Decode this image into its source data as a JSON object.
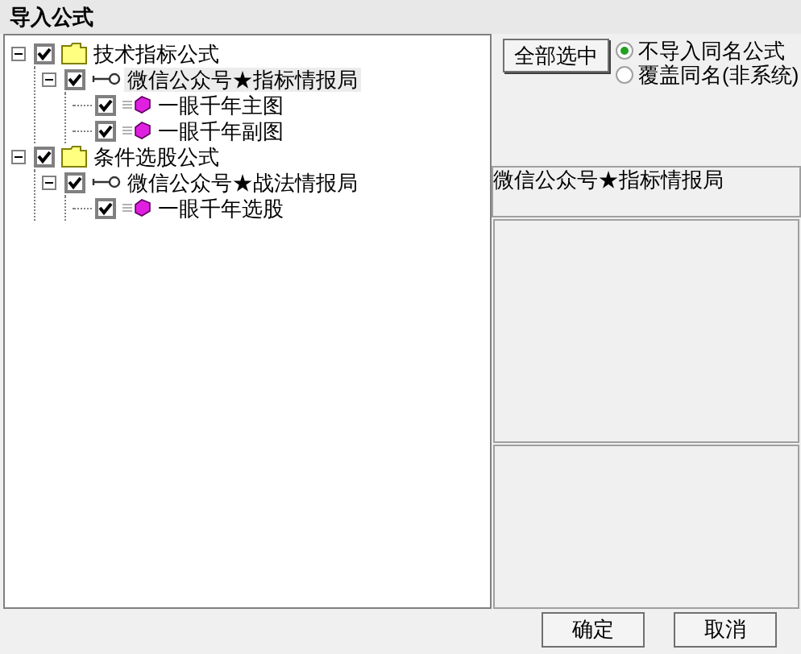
{
  "window": {
    "title": "导入公式"
  },
  "tree": [
    {
      "kind": "folder",
      "label": "技术指标公式",
      "checked": true,
      "expanded": true,
      "selected": false,
      "children": [
        {
          "kind": "group",
          "label": "微信公众号★指标情报局",
          "checked": true,
          "expanded": true,
          "selected": true,
          "children": [
            {
              "kind": "formula",
              "label": "一眼千年主图",
              "checked": true,
              "selected": false
            },
            {
              "kind": "formula",
              "label": "一眼千年副图",
              "checked": true,
              "selected": false
            }
          ]
        }
      ]
    },
    {
      "kind": "folder",
      "label": "条件选股公式",
      "checked": true,
      "expanded": true,
      "selected": false,
      "children": [
        {
          "kind": "group",
          "label": "微信公众号★战法情报局",
          "checked": true,
          "expanded": true,
          "selected": false,
          "children": [
            {
              "kind": "formula",
              "label": "一眼千年选股",
              "checked": true,
              "selected": false
            }
          ]
        }
      ]
    }
  ],
  "select_all_button": "全部选中",
  "options": [
    {
      "label": "不导入同名公式",
      "selected": true
    },
    {
      "label": "覆盖同名(非系统)",
      "selected": false
    }
  ],
  "selected_name": "微信公众号★指标情报局",
  "buttons": [
    "确定",
    "取消"
  ]
}
